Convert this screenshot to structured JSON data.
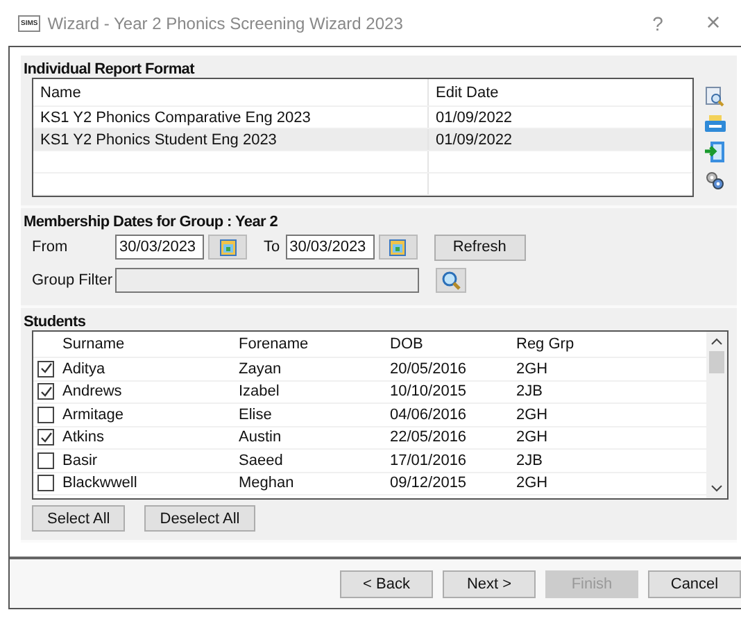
{
  "window": {
    "app_badge": "SIMS",
    "title": "Wizard - Year 2 Phonics Screening Wizard 2023",
    "help": "?",
    "close": "×"
  },
  "report_format": {
    "heading": "Individual Report Format",
    "columns": [
      "Name",
      "Edit Date"
    ],
    "rows": [
      {
        "name": "KS1 Y2 Phonics Comparative Eng 2023",
        "edit_date": "01/09/2022",
        "selected": false
      },
      {
        "name": "KS1 Y2 Phonics Student Eng 2023",
        "edit_date": "01/09/2022",
        "selected": true
      }
    ]
  },
  "membership": {
    "heading": "Membership Dates for Group : Year 2",
    "from_label": "From",
    "from": "30/03/2023",
    "to_label": "To",
    "to": "30/03/2023",
    "refresh": "Refresh",
    "filter_label": "Group Filter"
  },
  "students": {
    "heading": "Students",
    "columns": [
      "Surname",
      "Forename",
      "DOB",
      "Reg Grp"
    ],
    "rows": [
      {
        "surname": "Aditya",
        "forename": "Zayan",
        "dob": "20/05/2016",
        "reg": "2GH",
        "checked": true
      },
      {
        "surname": "Andrews",
        "forename": "Izabel",
        "dob": "10/10/2015",
        "reg": "2JB",
        "checked": true
      },
      {
        "surname": "Armitage",
        "forename": "Elise",
        "dob": "04/06/2016",
        "reg": "2GH",
        "checked": false
      },
      {
        "surname": "Atkins",
        "forename": "Austin",
        "dob": "22/05/2016",
        "reg": "2GH",
        "checked": true
      },
      {
        "surname": "Basir",
        "forename": "Saeed",
        "dob": "17/01/2016",
        "reg": "2JB",
        "checked": false
      },
      {
        "surname": "Blackwwell",
        "forename": "Meghan",
        "dob": "09/12/2015",
        "reg": "2GH",
        "checked": false
      }
    ],
    "select_all": "Select All",
    "deselect_all": "Deselect All"
  },
  "buttons": [
    {
      "label": "< Back",
      "disabled": false
    },
    {
      "label": "Next >",
      "disabled": false
    },
    {
      "label": "Finish",
      "disabled": true
    },
    {
      "label": "Cancel",
      "disabled": false
    }
  ]
}
